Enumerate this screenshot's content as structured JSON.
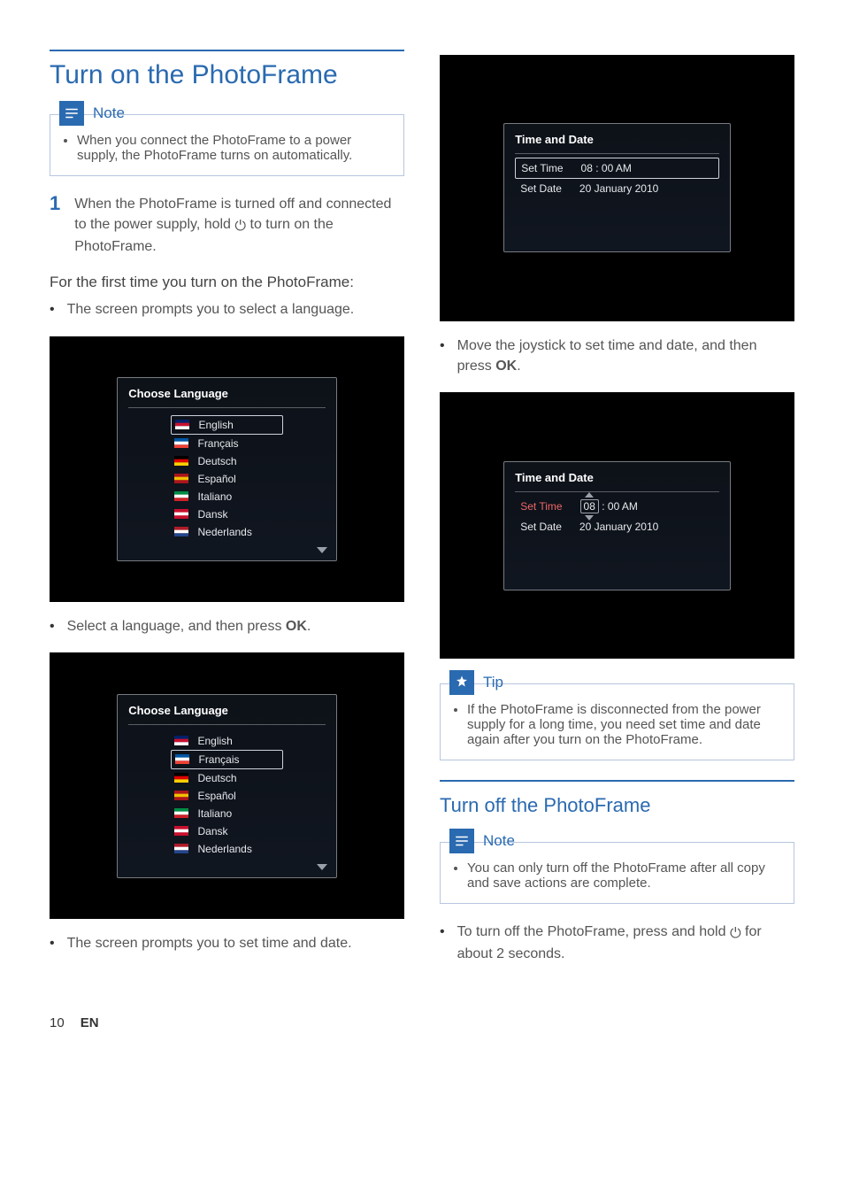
{
  "left": {
    "heading": "Turn on the PhotoFrame",
    "note": {
      "label": "Note",
      "text": "When you connect the PhotoFrame to a power supply, the PhotoFrame turns on automatically."
    },
    "step1": {
      "num": "1",
      "textA": "When the PhotoFrame is turned off and connected to the power supply, hold ",
      "textB": " to turn on the PhotoFrame."
    },
    "subhead": "For the first time you turn on the PhotoFrame:",
    "bullet1": "The screen prompts you to select a language.",
    "langMenu": {
      "title": "Choose Language",
      "items": [
        "English",
        "Français",
        "Deutsch",
        "Español",
        "Italiano",
        "Dansk",
        "Nederlands"
      ]
    },
    "bullet2a": "Select a language, and then press ",
    "bullet2b": "OK",
    "bullet2c": ".",
    "shot2_activeIndex": 1,
    "bullet3": "The screen prompts you to set time and date."
  },
  "right": {
    "timeDate": {
      "title": "Time and Date",
      "row1Label": "Set Time",
      "row1Value": "08 : 00 AM",
      "row2Label": "Set Date",
      "row2Value": "20 January 2010",
      "hourTag": "08",
      "row1bRest": " : 00 AM"
    },
    "bullet1a": "Move the joystick to set time and date, and then press ",
    "bullet1b": "OK",
    "bullet1c": ".",
    "tip": {
      "label": "Tip",
      "text": "If the PhotoFrame is disconnected from the power supply for a long time, you need set time and date again after you turn on the PhotoFrame."
    },
    "heading2": "Turn off the PhotoFrame",
    "note2": {
      "label": "Note",
      "text": "You can only turn off the PhotoFrame after all copy and save actions are complete."
    },
    "bullet2a": "To turn off the PhotoFrame, press and hold ",
    "bullet2b": " for about 2 seconds."
  },
  "footer": {
    "page": "10",
    "lang": "EN"
  },
  "flags": {
    "English": [
      "#012169",
      "#c8102e",
      "#ffffff"
    ],
    "Français": [
      "#0055a4",
      "#ffffff",
      "#ef4135"
    ],
    "Deutsch": [
      "#000000",
      "#dd0000",
      "#ffce00"
    ],
    "Español": [
      "#aa151b",
      "#f1bf00",
      "#aa151b"
    ],
    "Italiano": [
      "#008c45",
      "#ffffff",
      "#cd212a"
    ],
    "Dansk": [
      "#c8102e",
      "#ffffff",
      "#c8102e"
    ],
    "Nederlands": [
      "#ae1c28",
      "#ffffff",
      "#21468b"
    ]
  }
}
